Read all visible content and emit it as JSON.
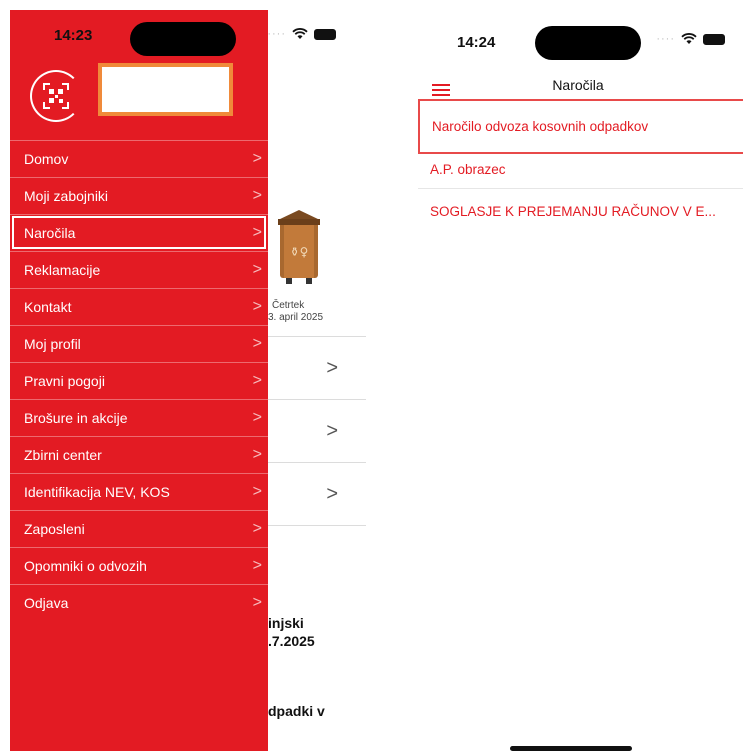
{
  "left": {
    "status_time": "14:23",
    "drawer_menu": [
      {
        "label": "Domov",
        "name": "menu-item-domov"
      },
      {
        "label": "Moji zabojniki",
        "name": "menu-item-moji-zabojniki"
      },
      {
        "label": "Naročila",
        "name": "menu-item-narocila"
      },
      {
        "label": "Reklamacije",
        "name": "menu-item-reklamacije"
      },
      {
        "label": "Kontakt",
        "name": "menu-item-kontakt"
      },
      {
        "label": "Moj profil",
        "name": "menu-item-moj-profil"
      },
      {
        "label": "Pravni pogoji",
        "name": "menu-item-pravni-pogoji"
      },
      {
        "label": "Brošure in akcije",
        "name": "menu-item-brosure"
      },
      {
        "label": "Zbirni center",
        "name": "menu-item-zbirni-center"
      },
      {
        "label": "Identifikacija NEV, KOS",
        "name": "menu-item-identifikacija"
      },
      {
        "label": "Zaposleni",
        "name": "menu-item-zaposleni"
      },
      {
        "label": "Opomniki o odvozih",
        "name": "menu-item-opomniki"
      },
      {
        "label": "Odjava",
        "name": "menu-item-odjava"
      }
    ],
    "chevron": ">",
    "background": {
      "bin_day": "Četrtek",
      "bin_date": "3. april 2025",
      "bold_1_line1": "injski",
      "bold_1_line2": ".7.2025",
      "bold_2": "dpadki v"
    }
  },
  "right": {
    "status_time": "14:24",
    "title": "Naročila",
    "items": [
      "Naročilo odvoza kosovnih odpadkov",
      "A.P. obrazec",
      "SOGLASJE K PREJEMANJU RAČUNOV V E..."
    ]
  },
  "colors": {
    "brand_red": "#e31b23",
    "highlight_orange": "#f08a3a"
  }
}
